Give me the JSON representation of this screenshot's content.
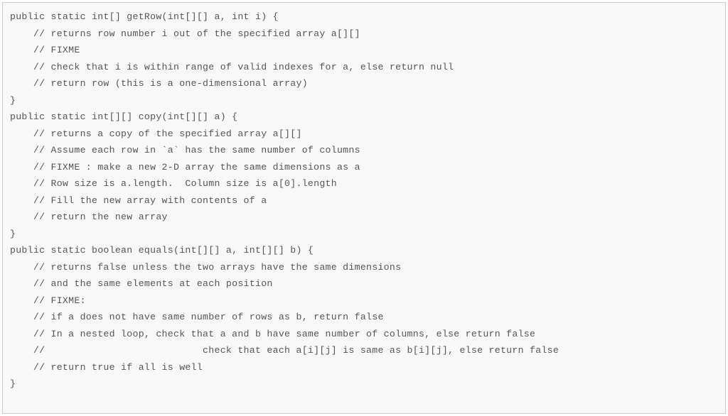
{
  "code": {
    "lines": [
      "public static int[] getRow(int[][] a, int i) {",
      "    // returns row number i out of the specified array a[][]",
      "    // FIXME",
      "    // check that i is within range of valid indexes for a, else return null",
      "    // return row (this is a one-dimensional array)",
      "}",
      "",
      "public static int[][] copy(int[][] a) {",
      "    // returns a copy of the specified array a[][]",
      "    // Assume each row in `a` has the same number of columns",
      "    // FIXME : make a new 2-D array the same dimensions as a",
      "    // Row size is a.length.  Column size is a[0].length",
      "    // Fill the new array with contents of a",
      "    // return the new array",
      "}",
      "",
      "public static boolean equals(int[][] a, int[][] b) {",
      "    // returns false unless the two arrays have the same dimensions",
      "    // and the same elements at each position",
      "    // FIXME:",
      "    // if a does not have same number of rows as b, return false",
      "    // In a nested loop, check that a and b have same number of columns, else return false",
      "    //                           check that each a[i][j] is same as b[i][j], else return false",
      "    // return true if all is well",
      "}"
    ]
  }
}
